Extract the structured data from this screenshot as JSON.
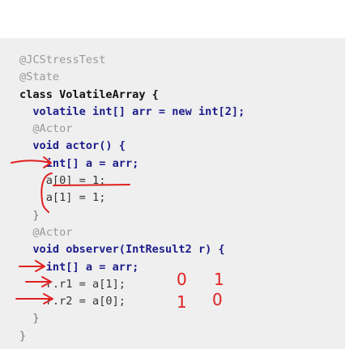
{
  "code": {
    "lines": [
      "@JCStressTest",
      "@State",
      "class VolatileArray {",
      "  volatile int[] arr = new int[2];",
      "  @Actor",
      "  void actor() {",
      "    int[] a = arr;",
      "    a[0] = 1;",
      "    a[1] = 1;",
      "  }",
      "  @Actor",
      "  void observer(IntResult2 r) {",
      "    int[] a = arr;",
      "    r.r1 = a[1];",
      "    r.r2 = a[0];",
      "  }",
      "}"
    ]
  },
  "handwriting": {
    "r1_left": "0",
    "r1_right": "1",
    "r2_left": "1",
    "r2_right": "0"
  },
  "colors": {
    "ink": "#e02020",
    "panel": "#efefef"
  }
}
